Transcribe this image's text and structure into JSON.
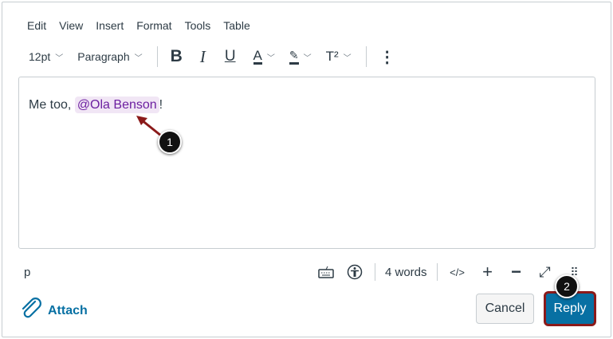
{
  "menu": [
    "Edit",
    "View",
    "Insert",
    "Format",
    "Tools",
    "Table"
  ],
  "toolbar": {
    "font_size": "12pt",
    "block": "Paragraph",
    "superscript": "T²"
  },
  "editor": {
    "text_before": "Me too, ",
    "mention": "@Ola Benson",
    "text_after": "!"
  },
  "status": {
    "element_path": "p",
    "word_count": "4 words",
    "html_toggle": "</>"
  },
  "actions": {
    "attach": "Attach",
    "cancel": "Cancel",
    "reply": "Reply"
  },
  "callouts": [
    "1",
    "2"
  ],
  "colors": {
    "accent": "#0770a3",
    "mention": "#6c1fa0",
    "callout_border": "#8b1a1a"
  }
}
